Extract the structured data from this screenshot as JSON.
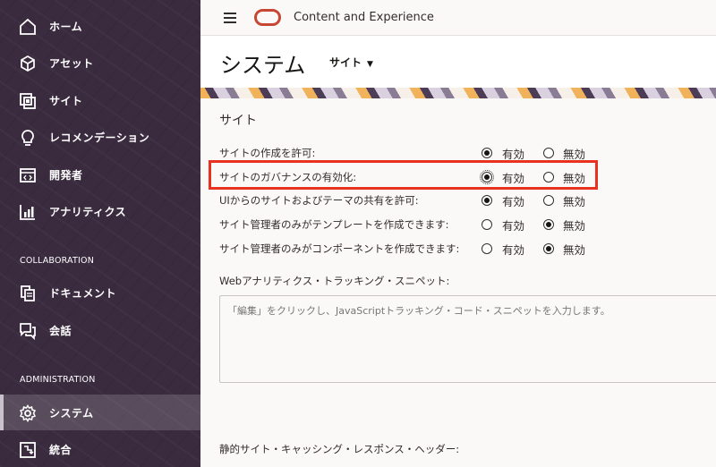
{
  "header": {
    "app_title": "Content and Experience",
    "page_title": "システム",
    "site_dropdown": "サイト"
  },
  "sidebar": {
    "items": [
      {
        "label": "ホーム",
        "icon": "home-icon"
      },
      {
        "label": "アセット",
        "icon": "cube-icon"
      },
      {
        "label": "サイト",
        "icon": "site-icon"
      },
      {
        "label": "レコメンデーション",
        "icon": "lightbulb-icon"
      },
      {
        "label": "開発者",
        "icon": "developer-icon"
      },
      {
        "label": "アナリティクス",
        "icon": "analytics-icon"
      }
    ],
    "collaboration_heading": "COLLABORATION",
    "collaboration_items": [
      {
        "label": "ドキュメント",
        "icon": "document-icon"
      },
      {
        "label": "会話",
        "icon": "conversation-icon"
      }
    ],
    "administration_heading": "ADMINISTRATION",
    "administration_items": [
      {
        "label": "システム",
        "icon": "gear-icon",
        "active": true
      },
      {
        "label": "統合",
        "icon": "integration-icon"
      }
    ]
  },
  "content": {
    "section_title": "サイト",
    "enabled_label": "有効",
    "disabled_label": "無効",
    "settings": [
      {
        "label": "サイトの作成を許可:",
        "value": "有効"
      },
      {
        "label": "サイトのガバナンスの有効化:",
        "value": "有効"
      },
      {
        "label": "UIからのサイトおよびテーマの共有を許可:",
        "value": "有効"
      },
      {
        "label": "サイト管理者のみがテンプレートを作成できます:",
        "value": "無効"
      },
      {
        "label": "サイト管理者のみがコンポーネントを作成できます:",
        "value": "無効"
      }
    ],
    "web_analytics_label": "Webアナリティクス・トラッキング・スニペット:",
    "web_analytics_placeholder": "「編集」をクリックし、JavaScriptトラッキング・コード・スニペットを入力します。",
    "static_cache_label": "静的サイト・キャッシング・レスポンス・ヘッダー:"
  },
  "colors": {
    "sidebar_bg": "#3a2b3f",
    "highlight": "#e8321f",
    "brand": "#c74634"
  }
}
